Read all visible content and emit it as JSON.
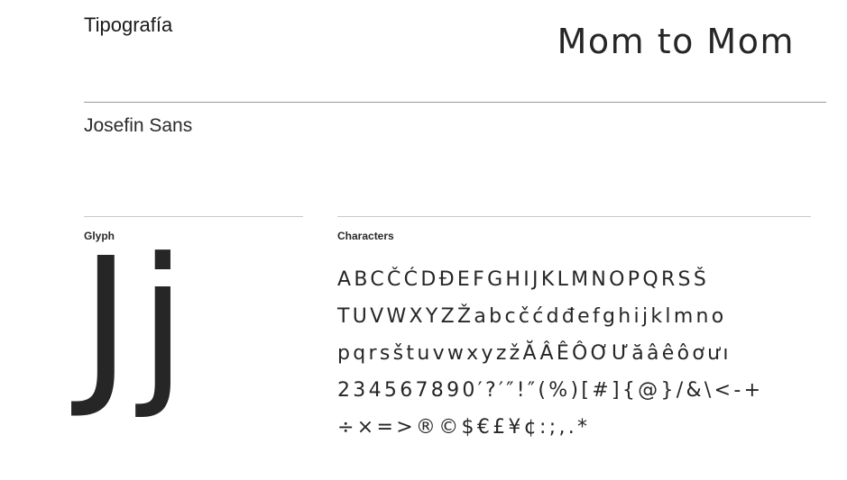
{
  "header": {
    "section_title": "Tipografía",
    "brand_title": "Mom to Mom"
  },
  "font": {
    "name": "Josefin Sans"
  },
  "glyph": {
    "label": "Glyph",
    "sample": "Jj"
  },
  "characters": {
    "label": "Characters",
    "lines": [
      "ABCČĆDĐEFGHIJKLMNOPQRSŠ",
      "TUVWXYZŽabcčćdđefghijklmno",
      "pqrsštuvwxyzžĂÂÊÔƠƯăâêôơưı",
      "234567890′?′″!″(%)[#]{@}/&\\<-+",
      "÷×=>®©$€£¥¢:;,.*"
    ]
  }
}
